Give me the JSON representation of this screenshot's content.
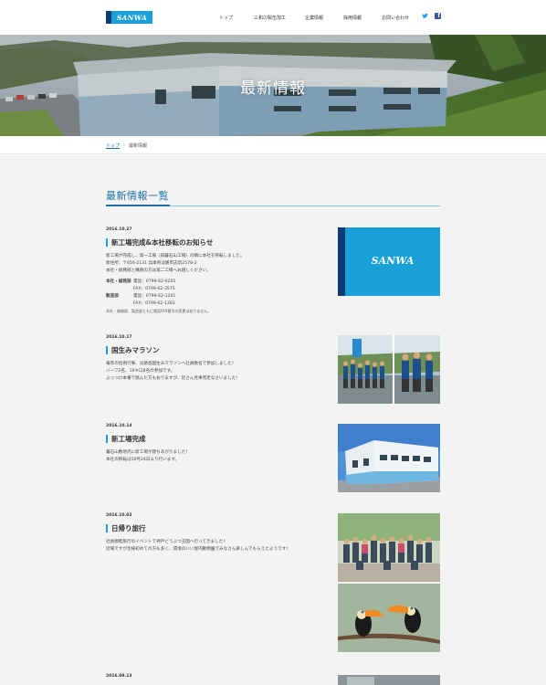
{
  "header": {
    "logo_text": "SANWA",
    "nav": [
      "トップ",
      "三和の製缶加工",
      "企業情報",
      "採用情報",
      "お問い合わせ"
    ]
  },
  "hero": {
    "title": "最新情報"
  },
  "breadcrumb": {
    "home": "トップ",
    "sep": "›",
    "current": "最新情報"
  },
  "section": {
    "title": "最新情報一覧"
  },
  "news": [
    {
      "date": "2016.10.27",
      "title": "新工場完成&本社移転のお知らせ",
      "lines": [
        "新工場が完成し、第一工場（旧暮石山工場）の隣に本社を移転しました。",
        "新住所：〒656-2131 兵庫県淡路市志筑2578-2",
        "本社・総務部と購買の方は第二工場へお越しください。"
      ],
      "contacts": [
        {
          "dept": "本社・総務部",
          "label1": "電話：0799-62-0205",
          "label2": "FAX：0799-62-3575"
        },
        {
          "dept": "製造部",
          "label1": "電話：0799-62-1201",
          "label2": "FAX：0799-62-1303"
        }
      ],
      "note": "本社・総務部、製造部ともに電話FAX番号の変更はありません。",
      "image_text": "SANWA"
    },
    {
      "date": "2016.10.17",
      "title": "国生みマラソン",
      "lines": [
        "毎年の恒例行事、淡路島国生みマラソンへ社員数名で参加しました！",
        "ハーフ2名、10キロ8名の参加です。",
        "ぶっつけ本番で挑んだ方もおりますが、皆さん見事完走なさいました！"
      ]
    },
    {
      "date": "2016.10.14",
      "title": "新工場完成",
      "lines": [
        "暮石山敷地内に新工場が建ちあがりました！",
        "本社の移転は10月24日より行います。"
      ]
    },
    {
      "date": "2016.10.03",
      "title": "日帰り旅行",
      "lines": [
        "社員親睦旅行のイベントで神戸どうぶつ王国へ行ってきました！",
        "近場ですが皆様初めての方も多く、環境のいい屋内動物園でみなさん楽しんでもらえたようです！"
      ]
    },
    {
      "date": "2016.09.13"
    }
  ],
  "colors": {
    "accent": "#1aa0d8",
    "title_blue": "#1c6fa7",
    "navy": "#0b3b75"
  }
}
